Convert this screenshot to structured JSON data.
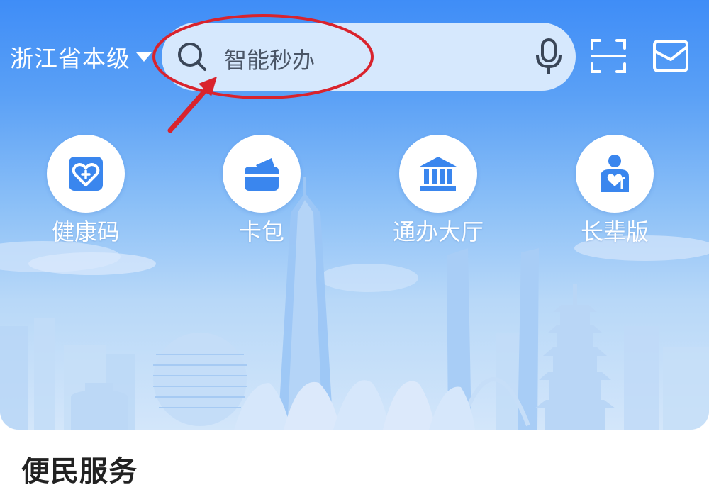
{
  "header": {
    "region": "浙江省本级",
    "search_placeholder": "智能秒办"
  },
  "icons": {
    "search": "search-icon",
    "mic": "mic-icon",
    "scan": "scan-icon",
    "message": "envelope-icon",
    "region_dropdown": "caret-down-icon"
  },
  "quick_entries": [
    {
      "label": "健康码",
      "icon": "health-code-heart-icon"
    },
    {
      "label": "卡包",
      "icon": "card-wallet-icon"
    },
    {
      "label": "通办大厅",
      "icon": "government-hall-icon"
    },
    {
      "label": "长辈版",
      "icon": "elder-mode-icon"
    }
  ],
  "section": {
    "title": "便民服务"
  },
  "colors": {
    "brand_blue": "#3f8df7",
    "icon_blue": "#3a86ee",
    "annotation_red": "#d9232d",
    "search_bg": "#d6e8fd"
  }
}
